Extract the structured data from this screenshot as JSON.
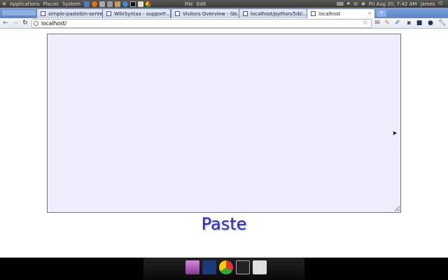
{
  "panel": {
    "menus": [
      "Applications",
      "Places",
      "System"
    ],
    "app_menus": [
      "File",
      "Edit"
    ],
    "clock": "Fri Aug 20,  7:42 AM",
    "user": "james"
  },
  "tabs": [
    {
      "label": "simple-pastebin-serve..."
    },
    {
      "label": "WikiSyntax - support ..."
    },
    {
      "label": "Visitors Overview - Go..."
    },
    {
      "label": "localhost/python/5dc..."
    },
    {
      "label": "localhost"
    }
  ],
  "toolbar": {
    "url": "localhost/"
  },
  "main": {
    "paste_value": "",
    "paste_button": "Paste"
  },
  "colors": {
    "textarea_bg": "#eeeeff",
    "paste_link": "#2a2ab8"
  }
}
